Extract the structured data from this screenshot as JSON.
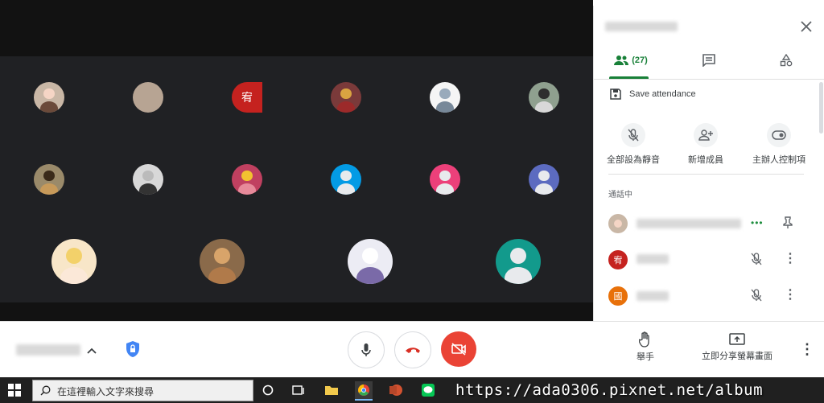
{
  "panel": {
    "close_icon": "close-icon",
    "tabs": {
      "people_count": "(27)",
      "people_icon": "people-icon",
      "chat_icon": "chat-icon",
      "activities_icon": "activities-icon"
    },
    "save_attendance": "Save attendance",
    "actions": [
      {
        "icon": "mic-off-icon",
        "label": "全部設為靜音"
      },
      {
        "icon": "add-person-icon",
        "label": "新增成員"
      },
      {
        "icon": "toggle-icon",
        "label": "主辦人控制項"
      }
    ],
    "section_label": "通話中",
    "participants": [
      {
        "initial": "宥",
        "color": "#c5221f"
      },
      {
        "initial": "國",
        "color": "#e8710a"
      }
    ]
  },
  "stage": {
    "tile_letter": "宥"
  },
  "bottombar": {
    "raise_hand_label": "舉手",
    "present_label": "立即分享螢幕畫面",
    "accent_red": "#ea4335"
  },
  "taskbar": {
    "search_placeholder": "在這裡輸入文字來搜尋"
  },
  "watermark": "https://ada0306.pixnet.net/album"
}
